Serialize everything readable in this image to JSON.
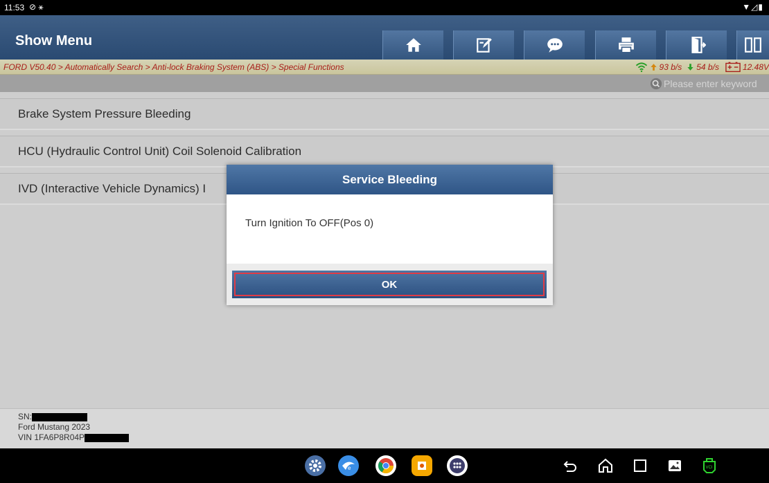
{
  "status_bar": {
    "time": "11:53",
    "left_icons": "⊘ ⚹",
    "right_icons": "▼◿▮"
  },
  "header": {
    "title": "Show Menu",
    "toolbar_icons": [
      "home-icon",
      "edit-icon",
      "chat-icon",
      "print-icon",
      "exit-icon",
      "split-view-icon"
    ]
  },
  "breadcrumb": {
    "path": "FORD V50.40 > Automatically Search > Anti-lock Braking System (ABS) > Special Functions"
  },
  "meters": {
    "upload": "93 b/s",
    "download": "54 b/s",
    "voltage": "12.48V"
  },
  "search": {
    "placeholder": "Please enter keyword"
  },
  "menu_items": [
    {
      "label": "Brake System Pressure Bleeding"
    },
    {
      "label": "HCU (Hydraulic Control Unit) Coil Solenoid Calibration"
    },
    {
      "label": "IVD (Interactive Vehicle Dynamics) I"
    }
  ],
  "dialog": {
    "title": "Service Bleeding",
    "message": "Turn Ignition To OFF(Pos 0)",
    "ok_label": "OK"
  },
  "info": {
    "sn_label": "SN:",
    "vehicle": "Ford Mustang 2023",
    "vin_label": "VIN 1FA6P8R04P"
  },
  "colors": {
    "header": "#2f5586",
    "crumb_text": "#c0231e",
    "ok_border": "#e23b45"
  }
}
